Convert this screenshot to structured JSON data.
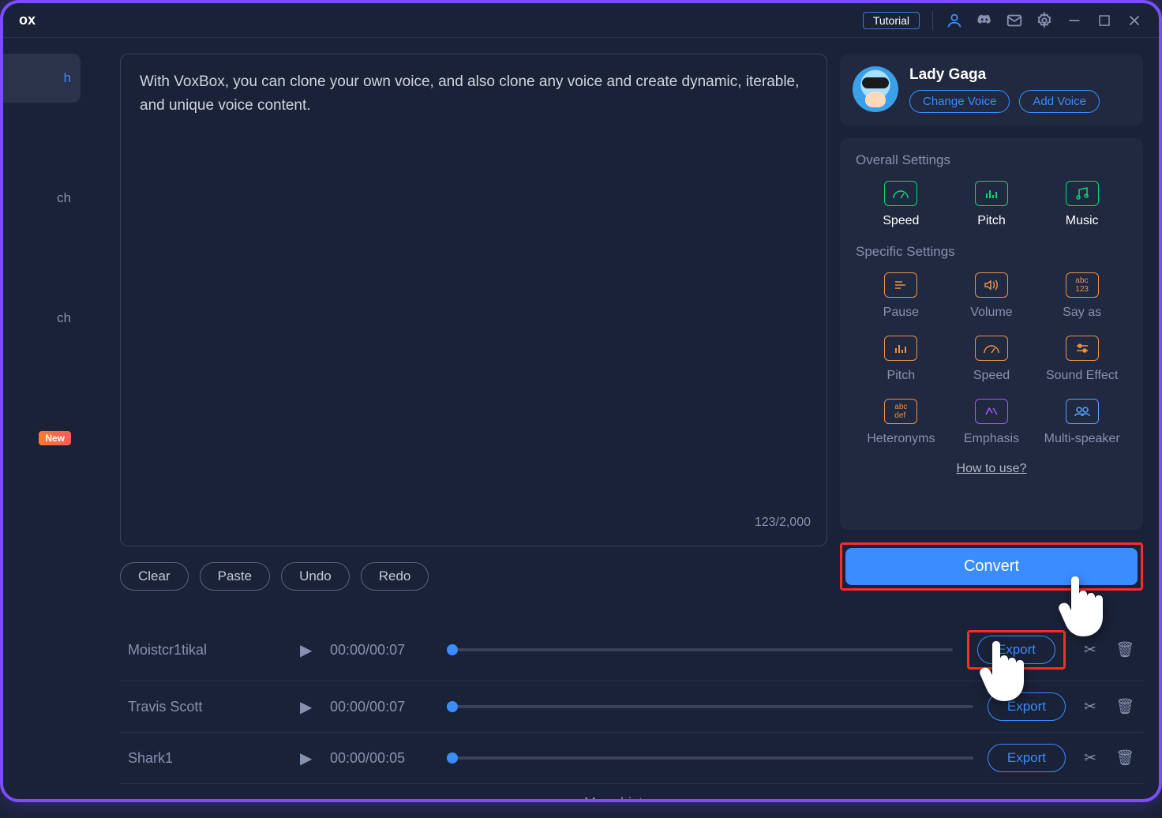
{
  "titlebar": {
    "app_name": "ox",
    "tutorial_label": "Tutorial"
  },
  "sidebar": {
    "items": [
      {
        "label": "h"
      },
      {
        "label": "ch"
      },
      {
        "label": "ch"
      }
    ],
    "new_badge": "New"
  },
  "editor": {
    "text": "With VoxBox, you can clone your own voice, and also clone any voice and create dynamic, iterable, and unique voice content.",
    "char_count": "123/2,000",
    "actions": {
      "clear": "Clear",
      "paste": "Paste",
      "undo": "Undo",
      "redo": "Redo"
    }
  },
  "voice": {
    "name": "Lady Gaga",
    "change_label": "Change Voice",
    "add_label": "Add Voice"
  },
  "settings": {
    "overall_label": "Overall Settings",
    "overall": [
      {
        "label": "Speed"
      },
      {
        "label": "Pitch"
      },
      {
        "label": "Music"
      }
    ],
    "specific_label": "Specific Settings",
    "specific": [
      {
        "label": "Pause"
      },
      {
        "label": "Volume"
      },
      {
        "label": "Say as"
      },
      {
        "label": "Pitch"
      },
      {
        "label": "Speed"
      },
      {
        "label": "Sound Effect"
      },
      {
        "label": "Heteronyms"
      },
      {
        "label": "Emphasis"
      },
      {
        "label": "Multi-speaker"
      }
    ],
    "how_to": "How to use?"
  },
  "convert_label": "Convert",
  "tracks": [
    {
      "name": "Moistcr1tikal",
      "time": "00:00/00:07",
      "export": "Export"
    },
    {
      "name": "Travis Scott",
      "time": "00:00/00:07",
      "export": "Export"
    },
    {
      "name": "Shark1",
      "time": "00:00/00:05",
      "export": "Export"
    }
  ],
  "more_history": "More history>>"
}
